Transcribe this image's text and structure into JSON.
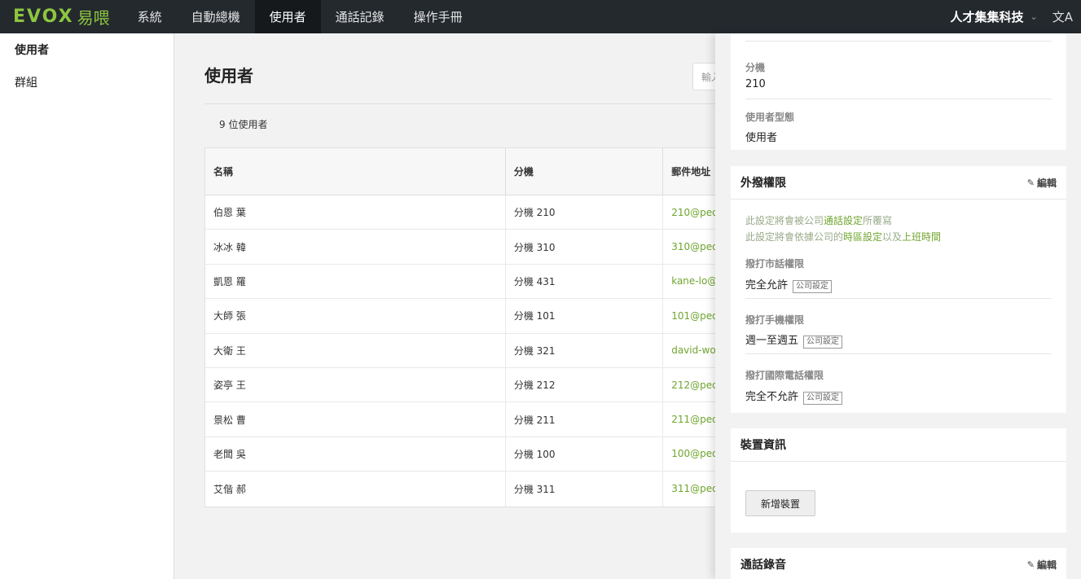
{
  "brand": {
    "logo_text": "EVOX",
    "logo_cn": "易喂",
    "accent": "#8cc63f"
  },
  "nav": {
    "items": [
      {
        "label": "系統"
      },
      {
        "label": "自動總機"
      },
      {
        "label": "使用者",
        "active": true
      },
      {
        "label": "通話記錄"
      },
      {
        "label": "操作手冊"
      }
    ],
    "company": "人才集集科技",
    "lang_icon": "translate-icon"
  },
  "sidebar": {
    "items": [
      {
        "label": "使用者",
        "active": true
      },
      {
        "label": "群組"
      }
    ]
  },
  "main": {
    "title": "使用者",
    "search_placeholder": "輸入",
    "user_count": "9 位使用者",
    "columns": [
      "名稱",
      "分機",
      "郵件地址"
    ],
    "rows": [
      {
        "name": "伯恩 葉",
        "ext": "分機 210",
        "email": "210@peop"
      },
      {
        "name": "冰冰 韓",
        "ext": "分機 310",
        "email": "310@peop"
      },
      {
        "name": "凱恩 羅",
        "ext": "分機 431",
        "email": "kane-lo@p"
      },
      {
        "name": "大師 張",
        "ext": "分機 101",
        "email": "101@peop"
      },
      {
        "name": "大衛 王",
        "ext": "分機 321",
        "email": "david-won"
      },
      {
        "name": "姿亭 王",
        "ext": "分機 212",
        "email": "212@peop"
      },
      {
        "name": "景松 曹",
        "ext": "分機 211",
        "email": "211@peop"
      },
      {
        "name": "老闆 吳",
        "ext": "分機 100",
        "email": "100@peop"
      },
      {
        "name": "艾偕 郝",
        "ext": "分機 311",
        "email": "311@peop"
      }
    ]
  },
  "drawer": {
    "basic": {
      "ext_label": "分機",
      "ext_value": "210",
      "type_label": "使用者型態",
      "type_value": "使用者"
    },
    "outbound": {
      "title": "外撥權限",
      "edit_label": "編輯",
      "note1_pre": "此設定將會被公司",
      "note1_link": "通話設定",
      "note1_post": "所覆寫",
      "note2_pre": "此設定將會依據公司的",
      "note2_link1": "時區設定",
      "note2_mid": "以及",
      "note2_link2": "上班時間",
      "local_label": "撥打市話權限",
      "local_value": "完全允許",
      "mobile_label": "撥打手機權限",
      "mobile_value": "週一至週五",
      "intl_label": "撥打國際電話權限",
      "intl_value": "完全不允許",
      "tag": "公司設定"
    },
    "device": {
      "title": "裝置資訊",
      "add_button": "新增裝置"
    },
    "recording": {
      "title": "通話錄音",
      "edit_label": "編輯"
    }
  }
}
